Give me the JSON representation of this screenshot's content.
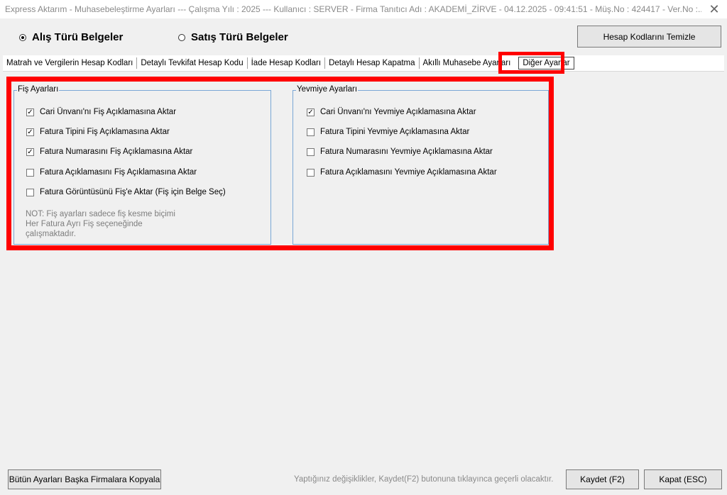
{
  "window": {
    "title": "Express Aktarım - Muhasebeleştirme Ayarları  ---  Çalışma Yılı : 2025  ---  Kullanıcı : SERVER - Firma Tanıtıcı Adı : AKADEMİ_ZİRVE - 04.12.2025 - 09:41:51 - Müş.No : 424417 - Ver.No :...",
    "close_glyph": "✕"
  },
  "doc_type": {
    "purchase_label": "Alış Türü Belgeler",
    "sales_label": "Satış Türü Belgeler",
    "selected": "purchase"
  },
  "clear_button": "Hesap Kodlarını Temizle",
  "tabs": [
    {
      "label": "Matrah ve Vergilerin Hesap Kodları"
    },
    {
      "label": "Detaylı Tevkifat Hesap Kodu"
    },
    {
      "label": "İade Hesap Kodları"
    },
    {
      "label": "Detaylı Hesap Kapatma"
    },
    {
      "label": "Akıllı Muhasebe Ayarları"
    },
    {
      "label": "Diğer Ayarlar"
    }
  ],
  "fis_group": {
    "legend": "Fiş Ayarları",
    "items": [
      {
        "label": "Cari Ünvanı'nı Fiş Açıklamasına Aktar",
        "checked": true,
        "mark": "✓"
      },
      {
        "label": "Fatura Tipini Fiş Açıklamasına Aktar",
        "checked": true,
        "mark": "✓"
      },
      {
        "label": "Fatura Numarasını Fiş Açıklamasına Aktar",
        "checked": true,
        "mark": "✓"
      },
      {
        "label": "Fatura Açıklamasını Fiş Açıklamasına Aktar",
        "checked": false,
        "mark": ""
      },
      {
        "label": "Fatura Görüntüsünü Fiş'e Aktar (Fiş için Belge Seç)",
        "checked": false,
        "mark": ""
      }
    ],
    "note_lines": [
      "NOT: Fiş ayarları sadece fiş kesme biçimi",
      "Her Fatura Ayrı Fiş seçeneğinde",
      "çalışmaktadır."
    ]
  },
  "yevmiye_group": {
    "legend": "Yevmiye Ayarları",
    "items": [
      {
        "label": "Cari Ünvanı'nı Yevmiye Açıklamasına Aktar",
        "checked": true,
        "mark": "✓"
      },
      {
        "label": "Fatura Tipini Yevmiye Açıklamasına Aktar",
        "checked": false,
        "mark": ""
      },
      {
        "label": "Fatura Numarasını Yevmiye Açıklamasına Aktar",
        "checked": false,
        "mark": ""
      },
      {
        "label": "Fatura Açıklamasını Yevmiye Açıklamasına Aktar",
        "checked": false,
        "mark": ""
      }
    ]
  },
  "footer": {
    "copy_button": "Bütün Ayarları Başka Firmalara Kopyala",
    "status_text": "Yaptığınız değişiklikler, Kaydet(F2) butonuna tıklayınca geçerli olacaktır.",
    "save_button": "Kaydet (F2)",
    "close_button": "Kapat (ESC)"
  },
  "colors": {
    "highlight": "#ff0000",
    "group_border": "#7aa7d6"
  }
}
